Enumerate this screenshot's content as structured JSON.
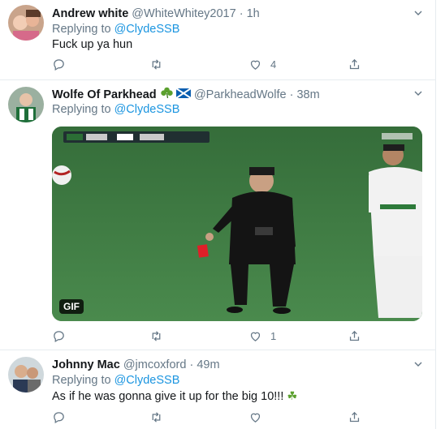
{
  "tweets": [
    {
      "name": "Andrew white",
      "handle": "@WhiteWhitey2017",
      "time": "1h",
      "replying_prefix": "Replying to ",
      "replying_to": "@ClydeSSB",
      "text": "Fuck up ya hun",
      "likes": "4"
    },
    {
      "name": "Wolfe Of Parkhead",
      "flags": "☘ 🏴",
      "handle": "@ParkheadWolfe",
      "time": "38m",
      "replying_prefix": "Replying to ",
      "replying_to": "@ClydeSSB",
      "media_badge": "GIF",
      "likes": "1"
    },
    {
      "name": "Johnny Mac",
      "handle": "@jmcoxford",
      "time": "49m",
      "replying_prefix": "Replying to ",
      "replying_to": "@ClydeSSB",
      "text": "As if he was gonna give it up for the big 10!!!",
      "text_emoji": "☘"
    }
  ],
  "separator": "·",
  "colors": {
    "link": "#1b95e0",
    "secondary": "#657786",
    "border": "#e6ecf0"
  },
  "icons": [
    "chevron-down-icon",
    "reply-icon",
    "retweet-icon",
    "like-icon",
    "share-icon"
  ]
}
